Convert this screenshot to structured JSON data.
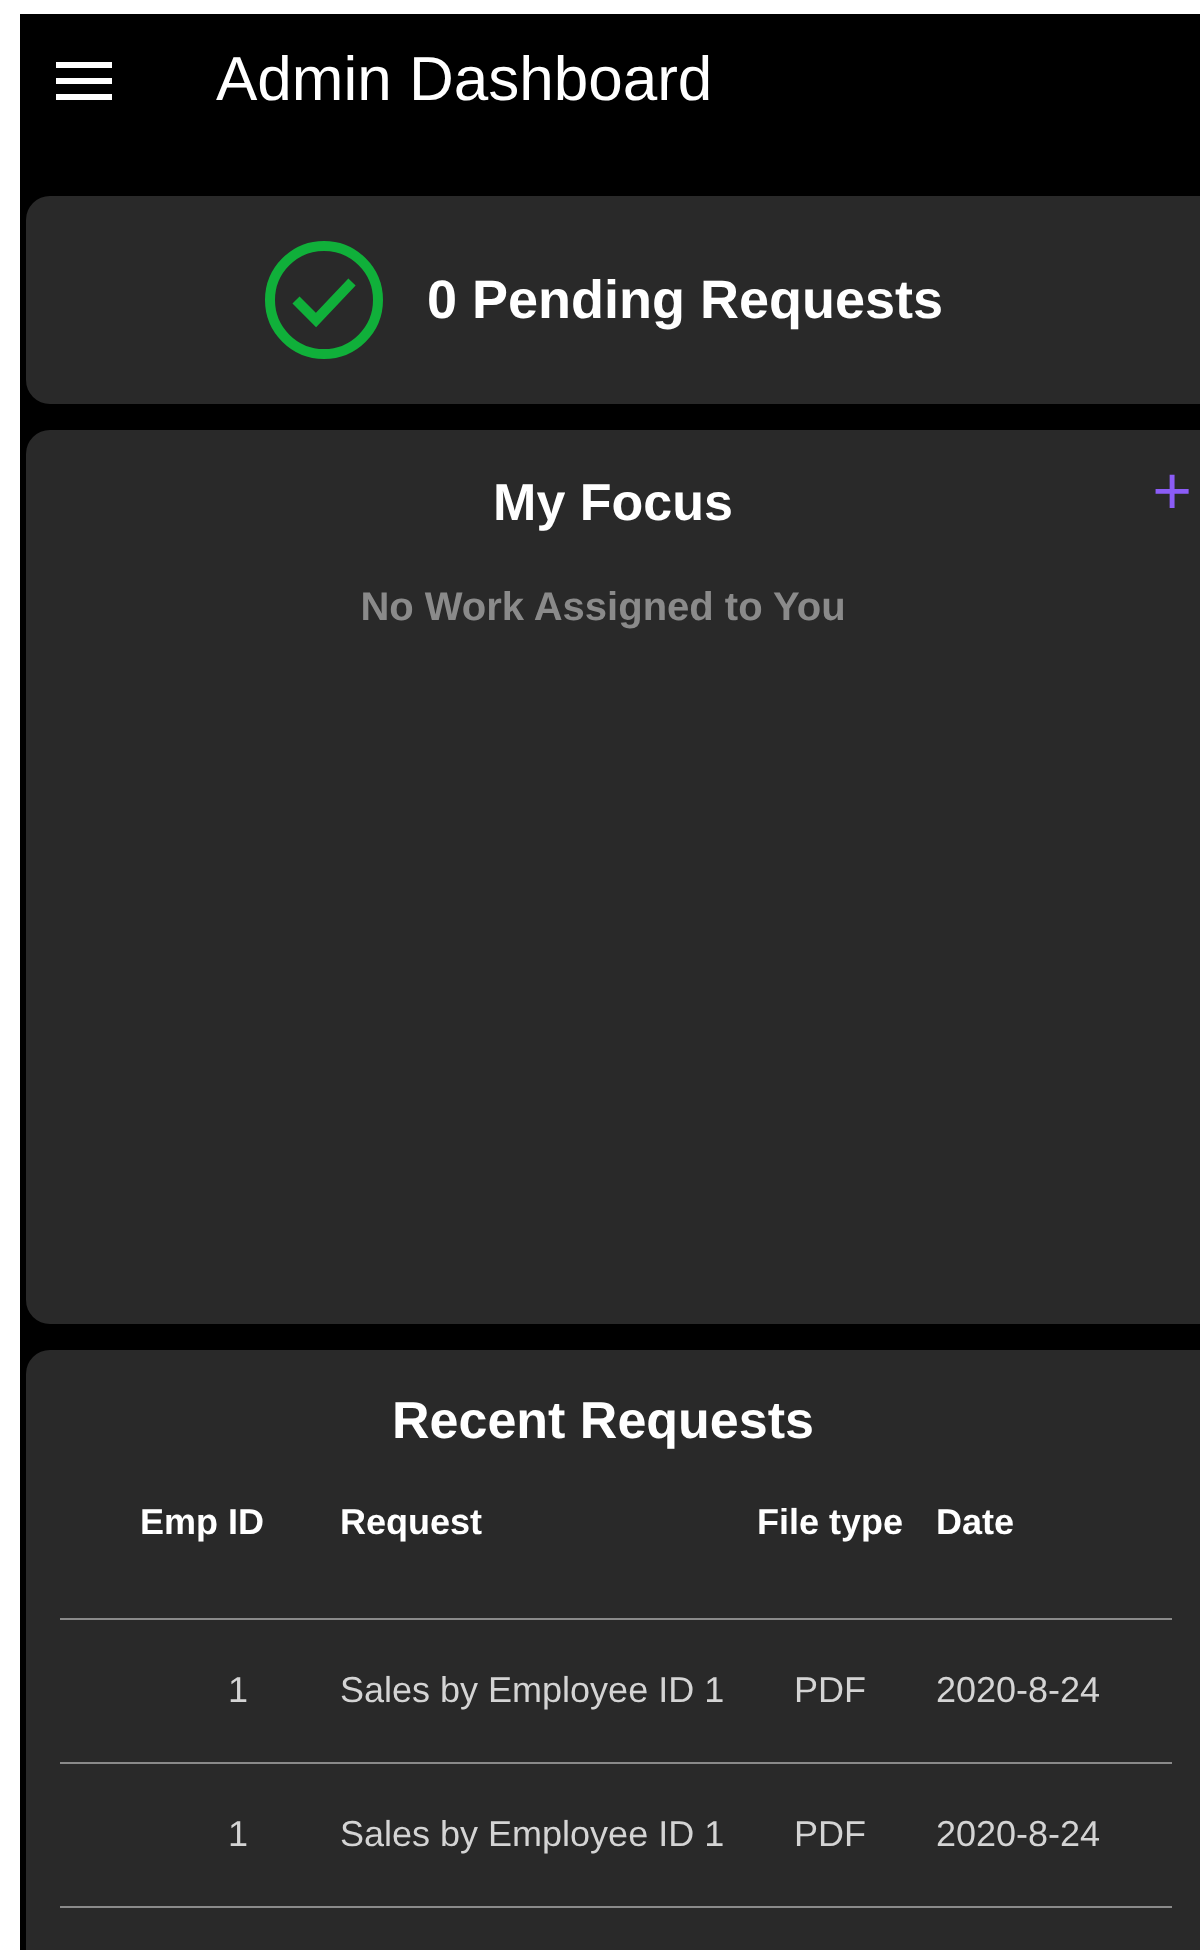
{
  "app_bar": {
    "title": "Admin Dashboard"
  },
  "pending": {
    "text": "0 Pending Requests"
  },
  "focus": {
    "title": "My Focus",
    "add": "+",
    "empty": "No Work Assigned to You"
  },
  "recent": {
    "title": "Recent Requests",
    "columns": [
      "Emp ID",
      "Request",
      "File type",
      "Date"
    ],
    "rows": [
      [
        "1",
        "Sales by Employee ID 1",
        "PDF",
        "2020-8-24"
      ],
      [
        "1",
        "Sales by Employee ID 1",
        "PDF",
        "2020-8-24"
      ]
    ]
  }
}
